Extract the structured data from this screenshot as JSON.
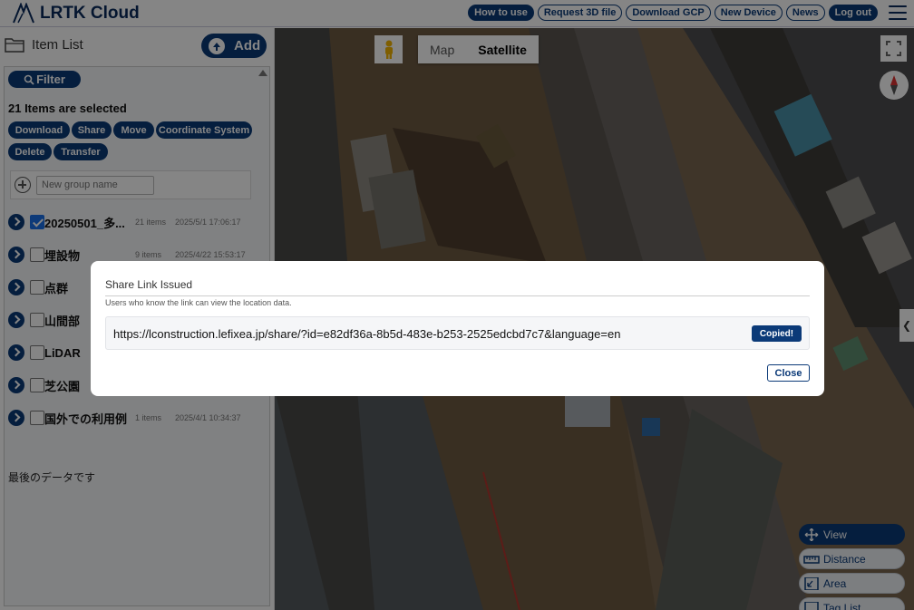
{
  "app": {
    "logo_text": "LRTK Cloud"
  },
  "nav": {
    "how_to_use": "How to use",
    "request_3d": "Request 3D file",
    "download_gcp": "Download GCP",
    "new_device": "New Device",
    "news": "News",
    "log_out": "Log out"
  },
  "sidebar": {
    "title": "Item List",
    "add_label": "Add",
    "filter_label": "Filter",
    "selected_text": "21 Items are selected",
    "actions": {
      "download": "Download",
      "share": "Share",
      "move": "Move",
      "coordinate_system": "Coordinate System",
      "delete": "Delete",
      "transfer": "Transfer"
    },
    "new_group_placeholder": "New group name",
    "items": [
      {
        "name": "20250501_多...",
        "count": "21 items",
        "date": "2025/5/1 17:06:17",
        "checked": true
      },
      {
        "name": "埋設物",
        "count": "9 items",
        "date": "2025/4/22 15:53:17",
        "checked": false
      },
      {
        "name": "点群",
        "count": "",
        "date": "",
        "checked": false
      },
      {
        "name": "山間部",
        "count": "",
        "date": "",
        "checked": false
      },
      {
        "name": "LiDAR",
        "count": "",
        "date": "",
        "checked": false
      },
      {
        "name": "芝公園",
        "count": "",
        "date": "",
        "checked": false
      },
      {
        "name": "国外での利用例",
        "count": "1 items",
        "date": "2025/4/1 10:34:37",
        "checked": false
      }
    ],
    "footer_note": "最後のデータです"
  },
  "map": {
    "map_label": "Map",
    "satellite_label": "Satellite",
    "tools": {
      "view": "View",
      "distance": "Distance",
      "area": "Area",
      "tag_list": "Tag List"
    }
  },
  "modal": {
    "title": "Share Link Issued",
    "description": "Users who know the link can view the location data.",
    "link": "https://lconstruction.lefixea.jp/share/?id=e82df36a-8b5d-483e-b253-2525edcbd7c7&language=en",
    "copied_label": "Copied!",
    "close_label": "Close"
  },
  "colors": {
    "brand": "#0b3a78",
    "checkbox": "#1a6fe8"
  }
}
